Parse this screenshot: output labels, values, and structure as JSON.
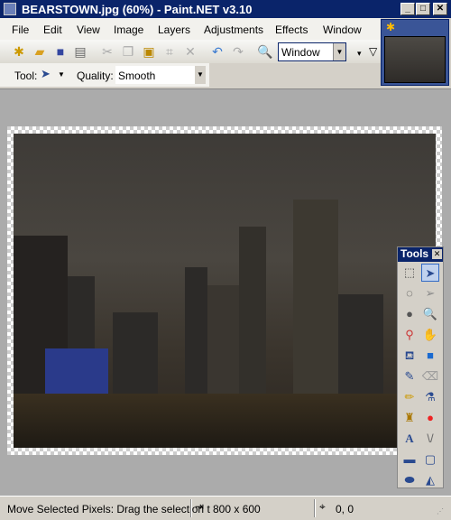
{
  "window": {
    "title": "BEARSTOWN.jpg (60%) - Paint.NET v3.10"
  },
  "menu": [
    "File",
    "Edit",
    "View",
    "Image",
    "Layers",
    "Adjustments",
    "Effects",
    "Window"
  ],
  "toolbar": {
    "icons": [
      "new-icon",
      "open-icon",
      "save-icon",
      "print-icon",
      "cut-icon",
      "copy-icon",
      "paste-icon",
      "crop-icon",
      "deselect-icon",
      "undo-icon",
      "redo-icon",
      "zoom-icon"
    ],
    "zoom_value": "Window"
  },
  "options": {
    "tool_label": "Tool:",
    "quality_label": "Quality:",
    "quality_value": "Smooth"
  },
  "tools": {
    "title": "Tools",
    "items": [
      "Rectangle Select",
      "Move Selected Pixels",
      "Lasso Select",
      "Move Selection",
      "Ellipse Select",
      "Zoom",
      "Magic Wand",
      "Pan",
      "Paint Bucket",
      "Gradient",
      "Paintbrush",
      "Eraser",
      "Pencil",
      "Color Picker",
      "Clone Stamp",
      "Recolor",
      "Text",
      "Line/Curve",
      "Rectangle",
      "Rounded Rectangle",
      "Ellipse",
      "Freeform Shape"
    ],
    "selected": "Move Selected Pixels"
  },
  "status": {
    "message": "Move Selected Pixels: Drag the selection t",
    "image_size": "800 x 600",
    "cursor": "0, 0"
  }
}
